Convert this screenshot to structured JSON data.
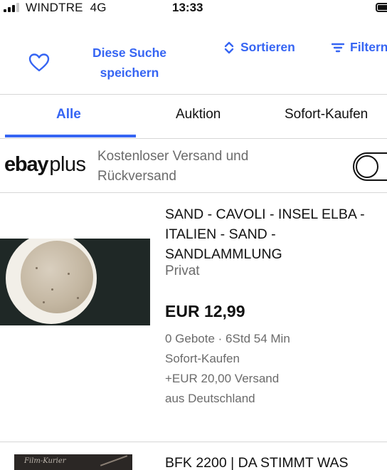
{
  "status_bar": {
    "carrier": "WINDTRE",
    "network": "4G",
    "time": "13:33"
  },
  "actions": {
    "save_search_line1": "Diese Suche",
    "save_search_line2": "speichern",
    "sort_label": "Sortieren",
    "filter_label": "Filtern"
  },
  "tabs": {
    "all": "Alle",
    "auction": "Auktion",
    "buy_now": "Sofort-Kaufen"
  },
  "ebay_plus": {
    "logo_ebay": "ebay",
    "logo_plus": "plus",
    "line1": "Kostenloser Versand und",
    "line2": "Rückversand",
    "toggle_on": false
  },
  "listings": [
    {
      "title_line1": "SAND - CAVOLI - INSEL ELBA -",
      "title_line2": "ITALIEN - SAND -",
      "title_line3": "SANDLAMMLUNG",
      "seller_type": "Privat",
      "price": "EUR 12,99",
      "bids_time": "0 Gebote · 6Std 54 Min",
      "format": "Sofort-Kaufen",
      "shipping": "+EUR 20,00 Versand",
      "location": "aus Deutschland"
    },
    {
      "title_line1": "BFK 2200 | DA STIMMT WAS",
      "thumb_text": "Film-Kurier"
    }
  ],
  "colors": {
    "accent": "#3665f3",
    "secondary_text": "#6b6b6b",
    "divider": "#d6d6d6"
  },
  "icons": {
    "heart": "heart-icon",
    "sort": "sort-arrows-icon",
    "filter": "filter-lines-icon"
  }
}
